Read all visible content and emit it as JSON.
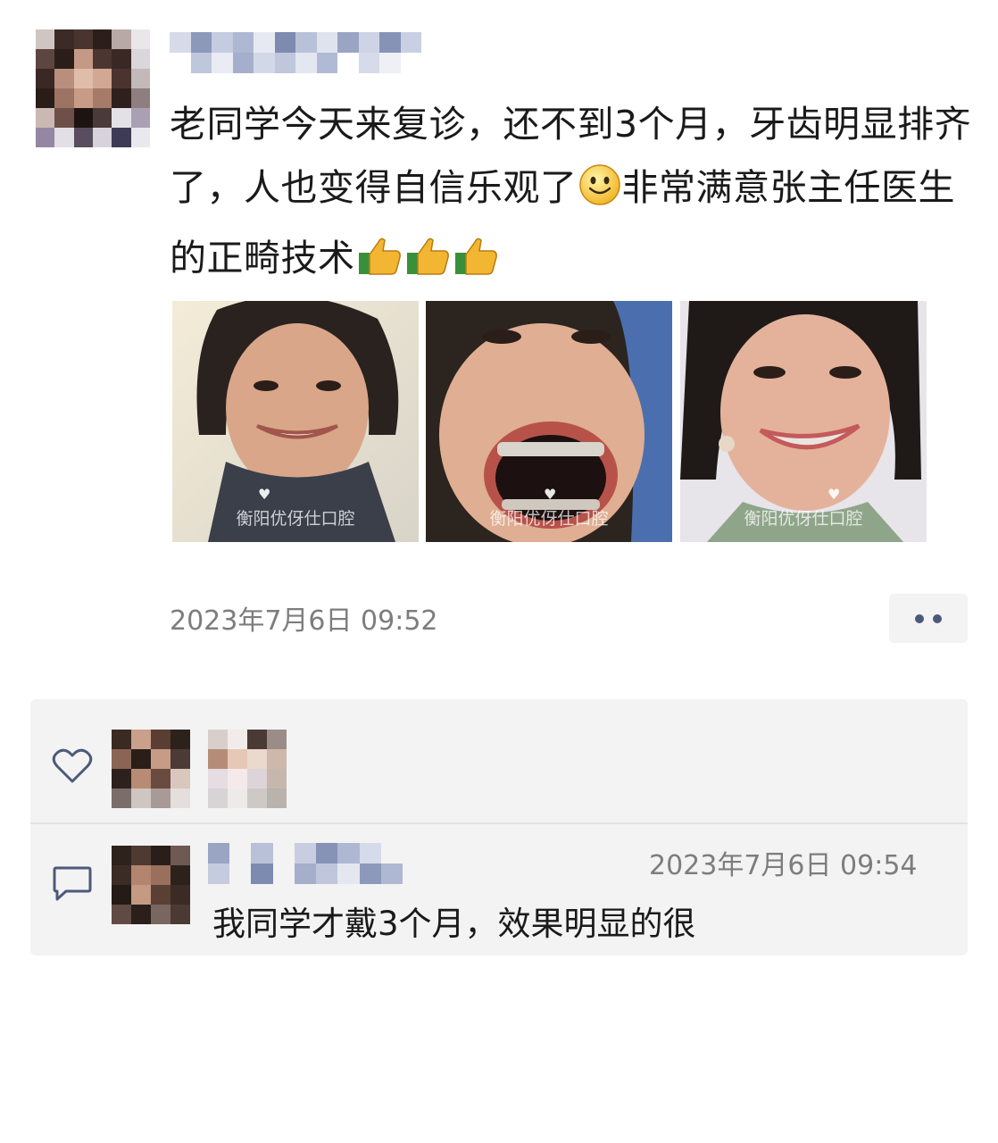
{
  "post": {
    "text": "老同学今天来复诊，还不到3个月，牙齿明显排齐了，人也变得自信乐观了",
    "text_continued": "非常满意张主任医生的正畸技术",
    "smile_emoji": "smile-emoji",
    "thumbs_emojis": [
      "thumbs-up-icon",
      "thumbs-up-icon",
      "thumbs-up-icon"
    ],
    "timestamp": "2023年7月6日 09:52",
    "photos": [
      {
        "watermark": "衡阳优伢仕口腔"
      },
      {
        "watermark": "衡阳优伢仕口腔"
      },
      {
        "watermark": "衡阳优伢仕口腔"
      }
    ]
  },
  "more_button": {
    "icon": "more-dots-icon"
  },
  "likes": {
    "icon": "heart-icon",
    "count_avatars": 2
  },
  "comment": {
    "icon": "comment-icon",
    "time": "2023年7月6日 09:54",
    "text": "我同学才戴3个月，效果明显的很"
  },
  "colors": {
    "link_blue": "#4c5a7a",
    "panel_bg": "#f3f3f3",
    "meta_gray": "#7d7d7d"
  }
}
